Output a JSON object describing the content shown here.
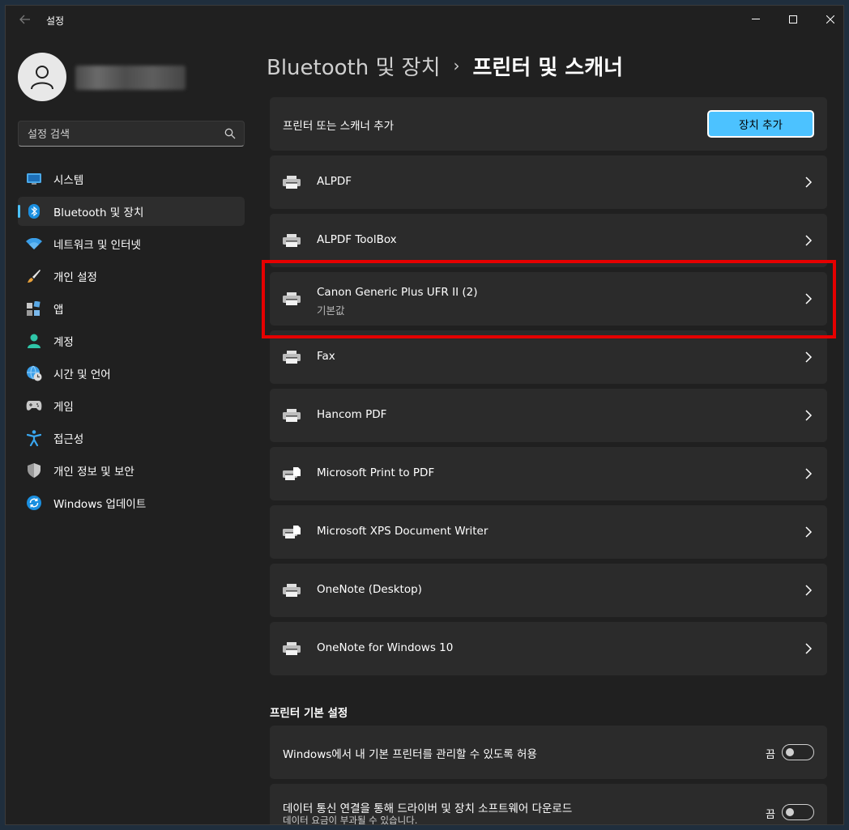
{
  "app": {
    "title": "설정"
  },
  "sidebar": {
    "search_placeholder": "설정 검색",
    "items": [
      {
        "label": "시스템",
        "icon": "monitor-icon"
      },
      {
        "label": "Bluetooth 및 장치",
        "icon": "bluetooth-icon",
        "active": true
      },
      {
        "label": "네트워크 및 인터넷",
        "icon": "wifi-icon"
      },
      {
        "label": "개인 설정",
        "icon": "brush-icon"
      },
      {
        "label": "앱",
        "icon": "apps-icon"
      },
      {
        "label": "계정",
        "icon": "account-icon"
      },
      {
        "label": "시간 및 언어",
        "icon": "globe-clock-icon"
      },
      {
        "label": "게임",
        "icon": "gamepad-icon"
      },
      {
        "label": "접근성",
        "icon": "accessibility-icon"
      },
      {
        "label": "개인 정보 및 보안",
        "icon": "shield-icon"
      },
      {
        "label": "Windows 업데이트",
        "icon": "update-icon"
      }
    ]
  },
  "breadcrumb": {
    "parent": "Bluetooth 및 장치",
    "separator": "›",
    "current": "프린터 및 스캐너"
  },
  "add_device": {
    "label": "프린터 또는 스캐너 추가",
    "button": "장치 추가"
  },
  "printers": [
    {
      "name": "ALPDF"
    },
    {
      "name": "ALPDF ToolBox"
    },
    {
      "name": "Canon Generic Plus UFR II (2)",
      "sub": "기본값"
    },
    {
      "name": "Fax"
    },
    {
      "name": "Hancom PDF"
    },
    {
      "name": "Microsoft Print to PDF"
    },
    {
      "name": "Microsoft XPS Document Writer"
    },
    {
      "name": "OneNote (Desktop)"
    },
    {
      "name": "OneNote for Windows 10"
    }
  ],
  "preferences": {
    "title": "프린터 기본 설정",
    "items": [
      {
        "label": "Windows에서 내 기본 프린터를 관리할 수 있도록 허용",
        "state": "끔"
      },
      {
        "label": "데이터 통신 연결을 통해 드라이버 및 장치 소프트웨어 다운로드",
        "sub": "데이터 요금이 부과될 수 있습니다.",
        "state": "끔"
      }
    ]
  },
  "colors": {
    "accent": "#4cc2ff",
    "highlight": "#e60000",
    "background": "#202020",
    "card": "#2b2b2b"
  }
}
